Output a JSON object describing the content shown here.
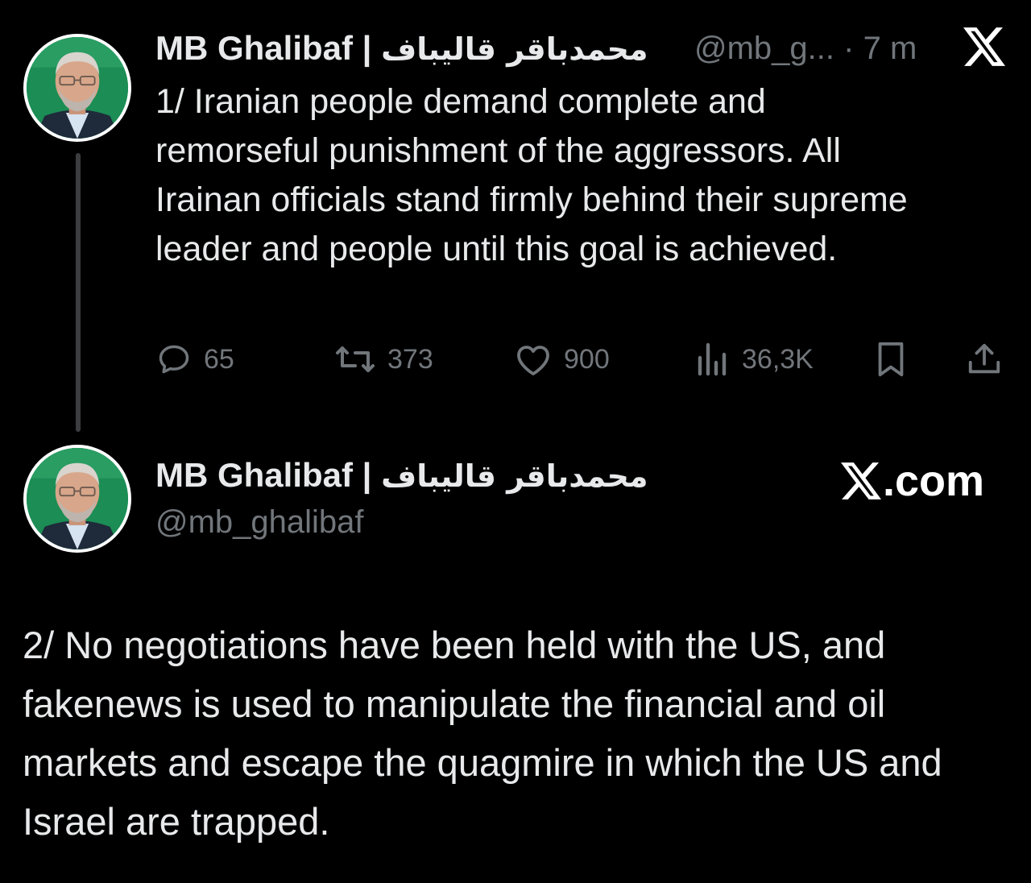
{
  "tweet1": {
    "author_name": "MB Ghalibaf |",
    "author_name_arabic": "محمدباقر قالیباف",
    "handle_truncated": "@mb_g...",
    "separator": "·",
    "time": "7 m",
    "text": "1/ Iranian people demand complete and remorseful punishment of the aggressors. All Irainan officials stand firmly behind their supreme leader and people until this goal is achieved.",
    "replies": "65",
    "reposts": "373",
    "likes": "900",
    "views": "36,3K"
  },
  "tweet2": {
    "author_name": "MB Ghalibaf |",
    "author_name_arabic": "محمدباقر قالیباف",
    "handle": "@mb_ghalibaf",
    "watermark": ".com",
    "text": "2/ No negotiations have been held with the US, and fakenews is used to manipulate the financial and oil markets and escape the quagmire in which the US and Israel are trapped."
  },
  "colors": {
    "background": "#000000",
    "text_primary": "#e7e9ea",
    "text_muted": "#71767b",
    "thread_line": "#3b3d40"
  },
  "icons": {
    "reply": "reply-bubble-icon",
    "repost": "repost-arrows-icon",
    "like": "heart-icon",
    "views": "bar-chart-icon",
    "bookmark": "bookmark-icon",
    "share": "share-upload-icon",
    "brand": "x-logo-icon"
  }
}
